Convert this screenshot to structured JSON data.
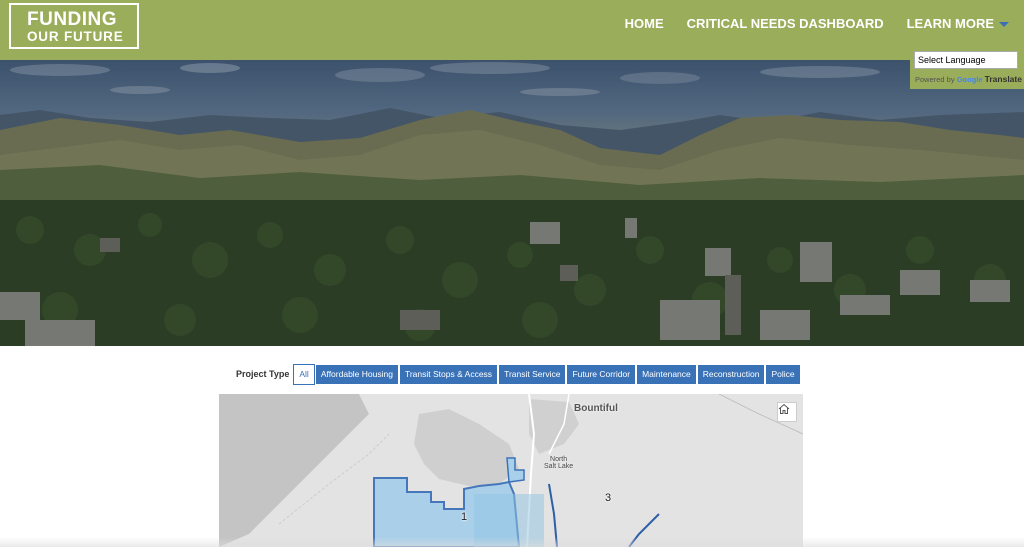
{
  "header": {
    "logo_line1": "FUNDING",
    "logo_line2": "OUR FUTURE",
    "nav": [
      {
        "label": "HOME"
      },
      {
        "label": "CRITICAL NEEDS DASHBOARD"
      },
      {
        "label": "LEARN MORE"
      }
    ]
  },
  "translate": {
    "selected": "Select Language",
    "powered_by": "Powered by",
    "google": "Google",
    "translate_label": "Translate"
  },
  "filters": {
    "label": "Project Type",
    "options": [
      {
        "label": "All",
        "active": true
      },
      {
        "label": "Affordable Housing",
        "active": false
      },
      {
        "label": "Transit Stops & Access",
        "active": false
      },
      {
        "label": "Transit Service",
        "active": false
      },
      {
        "label": "Future Corridor",
        "active": false
      },
      {
        "label": "Maintenance",
        "active": false
      },
      {
        "label": "Reconstruction",
        "active": false
      },
      {
        "label": "Police",
        "active": false
      }
    ]
  },
  "map": {
    "labels": {
      "bountiful": "Bountiful",
      "north": "North",
      "salt_lake": "Salt Lake"
    },
    "districts": [
      "1",
      "3"
    ],
    "colors": {
      "district_fill": "#a8d0ea",
      "district_stroke": "#3e72b8"
    }
  }
}
